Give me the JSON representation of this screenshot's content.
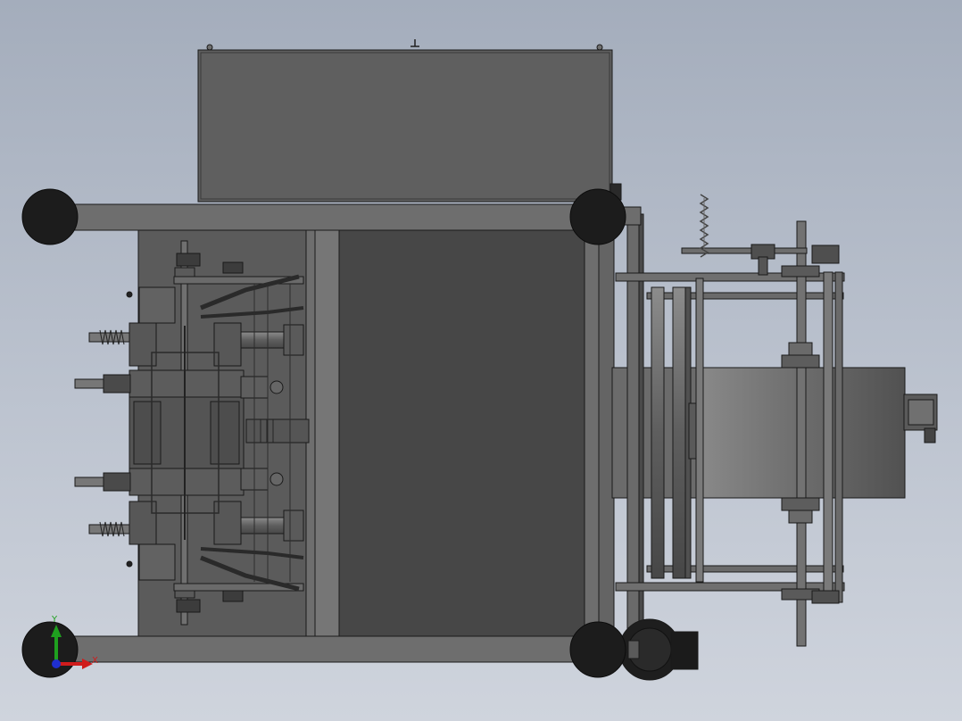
{
  "view": {
    "kind": "cad-model-viewport",
    "projection": "top view",
    "background_gradient": [
      "#a4adbc",
      "#cfd4dd"
    ],
    "colors": {
      "machine_dark": "#454545",
      "panel": "#5e5e5e",
      "frame": "#6e6e6e",
      "casters": "#1c1c1c",
      "edges": "#1a1a1a"
    }
  },
  "triad": {
    "x_axis": {
      "label": "X",
      "color": "#d01c1c"
    },
    "y_axis": {
      "label": "Y",
      "color": "#1fa01f"
    },
    "z_axis": {
      "color": "#1f2fd0"
    }
  }
}
